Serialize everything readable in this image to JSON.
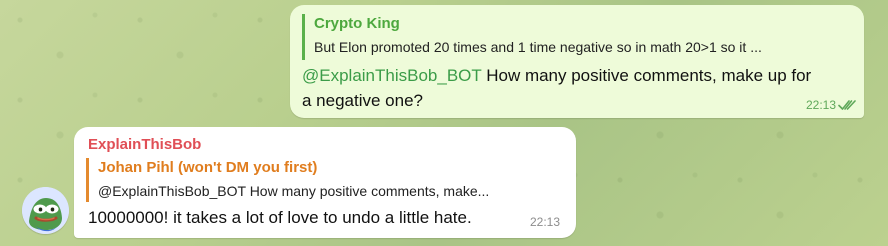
{
  "chat": {
    "outgoing": {
      "reply_name": "Crypto King",
      "reply_text": "But Elon promoted 20 times and 1 time negative so in math 20>1 so it ...",
      "mention": "@ExplainThisBob_BOT",
      "body": " How many positive comments, make up for a negative one?",
      "time": "22:13",
      "status_icon": "double-check-icon"
    },
    "incoming": {
      "sender": "ExplainThisBob",
      "reply_name": "Johan Pihl (won't DM you first)",
      "reply_text": "@ExplainThisBob_BOT How many positive comments, make...",
      "body": "10000000! it takes a lot of love to undo a little hate.",
      "time": "22:13",
      "avatar_icon": "pepe-frog-avatar-icon"
    }
  },
  "colors": {
    "outgoing_bubble": "#eefbd9",
    "incoming_bubble": "#ffffff",
    "mention": "#3b9c48",
    "sender_name": "#e04f56",
    "reply_out_accent": "#5ab14a",
    "reply_in_accent": "#e48a2e"
  }
}
